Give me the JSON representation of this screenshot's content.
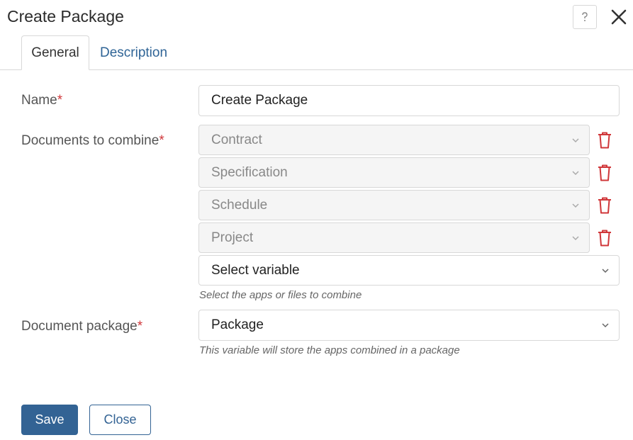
{
  "dialog": {
    "title": "Create Package",
    "help_icon": "question-icon",
    "close_icon": "close-icon"
  },
  "tabs": [
    {
      "label": "General",
      "active": true
    },
    {
      "label": "Description",
      "active": false
    }
  ],
  "form": {
    "name": {
      "label": "Name",
      "required_mark": "*",
      "value": "Create Package"
    },
    "documents": {
      "label": "Documents to combine",
      "required_mark": "*",
      "items": [
        {
          "value": "Contract"
        },
        {
          "value": "Specification"
        },
        {
          "value": "Schedule"
        },
        {
          "value": "Project"
        }
      ],
      "select_placeholder": "Select variable",
      "hint": "Select the apps or files to combine"
    },
    "package": {
      "label": "Document package",
      "required_mark": "*",
      "value": "Package",
      "hint": "This variable will store the apps combined in a package"
    }
  },
  "footer": {
    "save_label": "Save",
    "close_label": "Close"
  },
  "colors": {
    "accent": "#336394",
    "link": "#2f6496",
    "required": "#d0373a",
    "delete": "#d0373a"
  }
}
